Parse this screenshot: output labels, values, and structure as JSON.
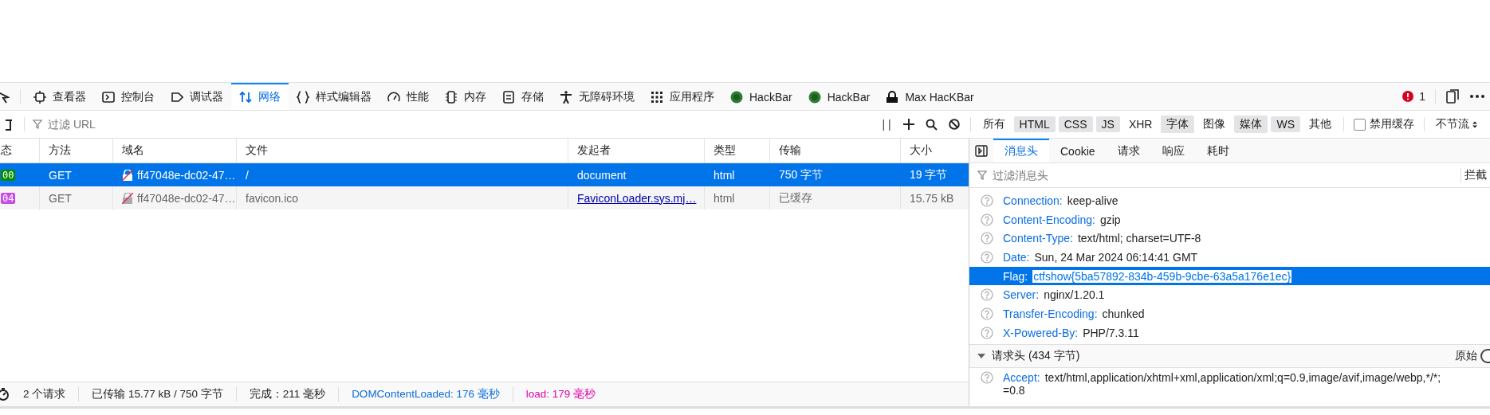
{
  "toolbar": {
    "tabs": [
      {
        "label": "查看器",
        "selected": false
      },
      {
        "label": "控制台",
        "selected": false
      },
      {
        "label": "调试器",
        "selected": false
      },
      {
        "label": "网络",
        "selected": true
      },
      {
        "label": "样式编辑器",
        "selected": false
      },
      {
        "label": "性能",
        "selected": false
      },
      {
        "label": "内存",
        "selected": false
      },
      {
        "label": "存储",
        "selected": false
      },
      {
        "label": "无障碍环境",
        "selected": false
      },
      {
        "label": "应用程序",
        "selected": false
      },
      {
        "label": "HackBar",
        "selected": false
      },
      {
        "label": "HackBar",
        "selected": false
      },
      {
        "label": "Max HacKBar",
        "selected": false
      }
    ],
    "error_count": "1"
  },
  "filter_bar": {
    "placeholder": "过滤 URL",
    "pause": "| |",
    "types": [
      {
        "label": "所有",
        "selected": false
      },
      {
        "label": "HTML",
        "selected": true
      },
      {
        "label": "CSS",
        "selected": true
      },
      {
        "label": "JS",
        "selected": true
      },
      {
        "label": "XHR",
        "selected": false
      },
      {
        "label": "字体",
        "selected": true
      },
      {
        "label": "图像",
        "selected": false
      },
      {
        "label": "媒体",
        "selected": true
      },
      {
        "label": "WS",
        "selected": true
      },
      {
        "label": "其他",
        "selected": false
      }
    ],
    "disable_cache": {
      "label": "禁用缓存",
      "checked": false
    },
    "throttle": "不节流"
  },
  "table": {
    "columns": [
      "态",
      "方法",
      "域名",
      "文件",
      "发起者",
      "类型",
      "传输",
      "大小"
    ],
    "rows": [
      {
        "status": "00",
        "color": "#058b00",
        "method": "GET",
        "domain": "ff47048e-dc02-47…",
        "file": "/",
        "initiator": "document",
        "type": "html",
        "transfer": "750 字节",
        "size": "19 字节",
        "selected": true,
        "cached": false
      },
      {
        "status": "04",
        "color": "#c74de6",
        "method": "GET",
        "domain": "ff47048e-dc02-47…",
        "file": "favicon.ico",
        "initiator": "FaviconLoader.sys.mj…",
        "type": "html",
        "transfer": "已缓存",
        "size": "15.75 kB",
        "selected": false,
        "cached": true
      }
    ]
  },
  "details": {
    "tabs": [
      {
        "label": "消息头",
        "selected": true
      },
      {
        "label": "Cookie",
        "selected": false
      },
      {
        "label": "请求",
        "selected": false
      },
      {
        "label": "响应",
        "selected": false
      },
      {
        "label": "耗时",
        "selected": false
      }
    ],
    "filter_placeholder": "过滤消息头",
    "block_button": "拦截",
    "response_headers": [
      {
        "name": "Connection:",
        "value": "keep-alive",
        "selected": false
      },
      {
        "name": "Content-Encoding:",
        "value": "gzip",
        "selected": false
      },
      {
        "name": "Content-Type:",
        "value": "text/html; charset=UTF-8",
        "selected": false
      },
      {
        "name": "Date:",
        "value": "Sun, 24 Mar 2024 06:14:41 GMT",
        "selected": false
      },
      {
        "name": "Flag:",
        "value": "ctfshow{5ba57892-834b-459b-9cbe-63a5a176e1ec}",
        "selected": true
      },
      {
        "name": "Server:",
        "value": "nginx/1.20.1",
        "selected": false
      },
      {
        "name": "Transfer-Encoding:",
        "value": "chunked",
        "selected": false
      },
      {
        "name": "X-Powered-By:",
        "value": "PHP/7.3.11",
        "selected": false
      }
    ],
    "request_section": {
      "title": "请求头 (434 字节)",
      "expanded": true,
      "raw_label": "原始",
      "raw_on": false
    },
    "request_headers": [
      {
        "name": "Accept:",
        "value": "text/html,application/xhtml+xml,application/xml;q=0.9,image/avif,image/webp,*/*;",
        "continuation": "=0.8"
      }
    ]
  },
  "status_bar": [
    {
      "text": "2 个请求",
      "color": "#222222"
    },
    {
      "text": "已传输 15.77 kB / 750 字节",
      "color": "#222222"
    },
    {
      "text": "完成：211 毫秒",
      "color": "#222222"
    },
    {
      "text": "DOMContentLoaded: 176 毫秒",
      "color": "#0b6ed8"
    },
    {
      "text": "load: 179 毫秒",
      "color": "#e000b0"
    }
  ]
}
